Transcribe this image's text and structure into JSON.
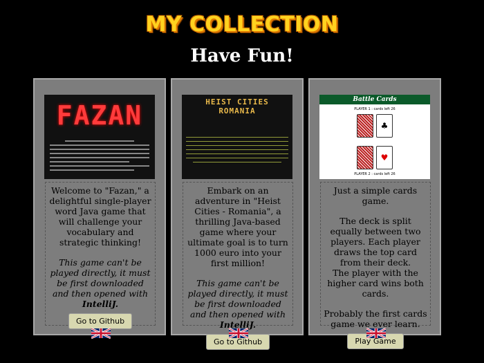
{
  "header": {
    "logo": "MY COLLECTION",
    "subtitle": "Have Fun!"
  },
  "cards": [
    {
      "desc": "Welcome to \"Fazan,\" a delightful single-player word Java game that will challenge your vocabulary and strategic thinking!",
      "note": "This game can't be played directly, it must be first downloaded and then opened with ",
      "note_bold": "IntelliJ.",
      "button": "Go to Github",
      "shot_title": "FAZAN"
    },
    {
      "desc": "Embark on an adventure in \"Heist Cities - Romania\", a thrilling Java-based game where your ultimate goal is to turn 1000 euro into your first million!",
      "note": "This game can't be played directly, it must be first downloaded and then opened with ",
      "note_bold": "IntelliJ.",
      "button": "Go to Github",
      "shot_title": "HEIST CITIES ROMANIA"
    },
    {
      "desc": "Just a simple cards game.",
      "desc2": "The deck is split equally between two players. Each player draws the top card from their deck.",
      "desc3": "The player with the higher card wins both cards.",
      "desc4": "Probably the first cards game we ever learn.",
      "button": "Play Game",
      "shot_title": "Battle Cards",
      "shot_p1": "PLAYER 1 : cards left 26",
      "shot_p2": "PLAYER 2 : cards left 26"
    }
  ],
  "icons": {
    "flag": "uk-flag-icon"
  },
  "colors": {
    "background": "#000000",
    "card": "#7d7d7d",
    "button": "#d8d8b0",
    "logo": "#ffd21f"
  }
}
